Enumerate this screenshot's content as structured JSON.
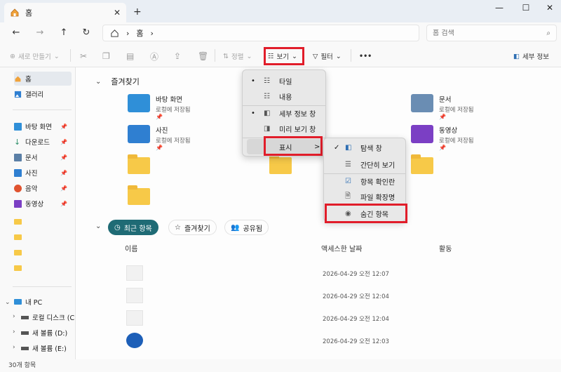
{
  "window": {
    "tab_title": "홈",
    "new_tab_symbol": "+",
    "close_symbol": "✕",
    "minimize_symbol": "—",
    "maximize_symbol": "☐"
  },
  "nav": {
    "back": "←",
    "forward": "→",
    "up": "↑",
    "refresh": "↻",
    "breadcrumb": [
      "홈"
    ],
    "search_placeholder": "홈 검색"
  },
  "toolbar": {
    "new_label": "새로 만들기",
    "sort_label": "정렬",
    "view_label": "보기",
    "filter_label": "필터",
    "more_label": "•••",
    "details_label": "세부 정보"
  },
  "sidebar": {
    "top": [
      {
        "label": "홈",
        "icon": "home-icon"
      },
      {
        "label": "갤러리",
        "icon": "gallery-icon"
      }
    ],
    "pinned": [
      {
        "label": "바탕 화면",
        "icon": "desktop-icon"
      },
      {
        "label": "다운로드",
        "icon": "download-icon"
      },
      {
        "label": "문서",
        "icon": "document-icon"
      },
      {
        "label": "사진",
        "icon": "pictures-icon"
      },
      {
        "label": "음악",
        "icon": "music-icon"
      },
      {
        "label": "동영상",
        "icon": "video-icon"
      }
    ],
    "pc_label": "내 PC",
    "drives": [
      {
        "label": "로컬 디스크 (C"
      },
      {
        "label": "새 볼륨 (D:)"
      },
      {
        "label": "새 볼륨 (E:)"
      }
    ]
  },
  "main": {
    "favorites_title": "즐겨찾기",
    "favorites": [
      {
        "name": "바탕 화면",
        "sub": "로컬에 저장됨"
      },
      {
        "name": "사진",
        "sub": "로컬에 저장됨"
      },
      {
        "name": "문서",
        "sub": "로컬에 저장됨"
      },
      {
        "name": "동영상",
        "sub": "로컬에 저장됨"
      }
    ],
    "chips": [
      "최근 항목",
      "즐겨찾기",
      "공유됨"
    ],
    "columns": [
      "이름",
      "액세스한 날짜",
      "활동"
    ],
    "rows": [
      {
        "date": "2026-04-29 오전 12:07"
      },
      {
        "date": "2026-04-29 오전 12:04"
      },
      {
        "date": "2026-04-29 오전 12:04"
      },
      {
        "date": "2026-04-29 오전 12:03"
      }
    ]
  },
  "view_menu": [
    {
      "label": "타일",
      "bullet": "•"
    },
    {
      "label": "내용",
      "bullet": ""
    },
    {
      "label": "세부 정보 창",
      "bullet": "•"
    },
    {
      "label": "미리 보기 창",
      "bullet": ""
    },
    {
      "label": "표시",
      "bullet": "",
      "arrow": ">"
    }
  ],
  "show_menu": [
    {
      "label": "탐색 창",
      "check": "✓"
    },
    {
      "label": "간단히 보기",
      "check": ""
    },
    {
      "label": "항목 확인란",
      "check": ""
    },
    {
      "label": "파일 확장명",
      "check": ""
    },
    {
      "label": "숨긴 항목",
      "check": ""
    }
  ],
  "status": {
    "count": "30개 항목"
  },
  "colors": {
    "accent": "#1f6b75",
    "highlight": "#e11d2a",
    "folder": "#f7c948"
  }
}
